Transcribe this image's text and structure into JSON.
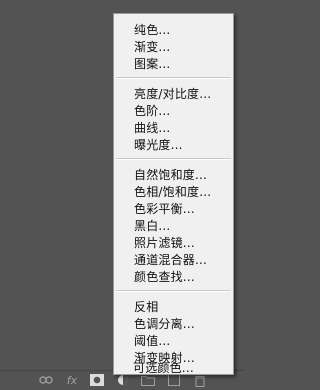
{
  "adjustment_menu": {
    "group1": [
      "纯色...",
      "渐变...",
      "图案..."
    ],
    "group2": [
      "亮度/对比度...",
      "色阶...",
      "曲线...",
      "曝光度..."
    ],
    "group3": [
      "自然饱和度...",
      "色相/饱和度...",
      "色彩平衡...",
      "黑白...",
      "照片滤镜...",
      "通道混合器...",
      "颜色查找..."
    ],
    "group4": [
      "反相",
      "色调分离...",
      "阈值...",
      "渐变映射...",
      "可选颜色..."
    ]
  },
  "layers_panel_footer": {
    "icons": [
      "link-icon",
      "fx-icon",
      "layer-mask-icon",
      "adjustment-layer-icon",
      "group-folder-icon",
      "new-layer-icon",
      "trash-icon"
    ],
    "fx_label": "fx"
  },
  "colors": {
    "panel": "#535353",
    "menu_bg": "#f0f0f0",
    "menu_text": "#101010"
  }
}
